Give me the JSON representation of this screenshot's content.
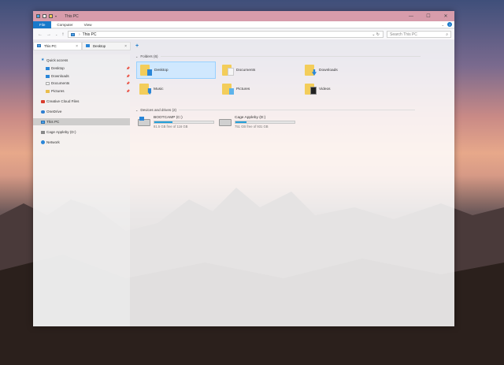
{
  "window": {
    "title": "This PC",
    "controls": [
      "—",
      "☐",
      "✕"
    ]
  },
  "ribbon": {
    "tabs": [
      "File",
      "Computer",
      "View"
    ],
    "help_label": "?"
  },
  "address": {
    "path": "This PC",
    "search_placeholder": "Search This PC"
  },
  "tabs": [
    {
      "label": "This PC",
      "active": true
    },
    {
      "label": "Desktop",
      "active": false
    }
  ],
  "sidebar": {
    "items": [
      {
        "label": "Quick access",
        "icon": "star-icon",
        "pinned": false
      },
      {
        "label": "Desktop",
        "icon": "folder-icon",
        "pinned": true
      },
      {
        "label": "Downloads",
        "icon": "folder-icon",
        "pinned": true
      },
      {
        "label": "Documents",
        "icon": "folder-icon",
        "pinned": true
      },
      {
        "label": "Pictures",
        "icon": "folder-icon",
        "pinned": true
      },
      {
        "label": "Creative Cloud Files",
        "icon": "creative-cloud-icon",
        "pinned": false
      },
      {
        "label": "OneDrive",
        "icon": "cloud-icon",
        "pinned": false
      },
      {
        "label": "This PC",
        "icon": "computer-icon",
        "pinned": false,
        "selected": true
      },
      {
        "label": "Cage Appleby (D:)",
        "icon": "drive-icon",
        "pinned": false
      },
      {
        "label": "Network",
        "icon": "network-icon",
        "pinned": false
      }
    ]
  },
  "folders": {
    "heading": "Folders (6)",
    "items": [
      "Desktop",
      "Documents",
      "Downloads",
      "Music",
      "Pictures",
      "Videos"
    ]
  },
  "drives": {
    "heading": "Devices and drives (2)",
    "items": [
      {
        "name": "BOOTCAMP (C:)",
        "free": "81.5 GB free of 116 GB",
        "used_fraction": 0.3
      },
      {
        "name": "Cage Appleby (D:)",
        "free": "751 GB free of 931 GB",
        "used_fraction": 0.19
      }
    ]
  },
  "colors": {
    "accent": "#1979ca",
    "titlebar": "#d79cab",
    "drive_bar": "#26a0da",
    "selection": "#cce8ff"
  }
}
